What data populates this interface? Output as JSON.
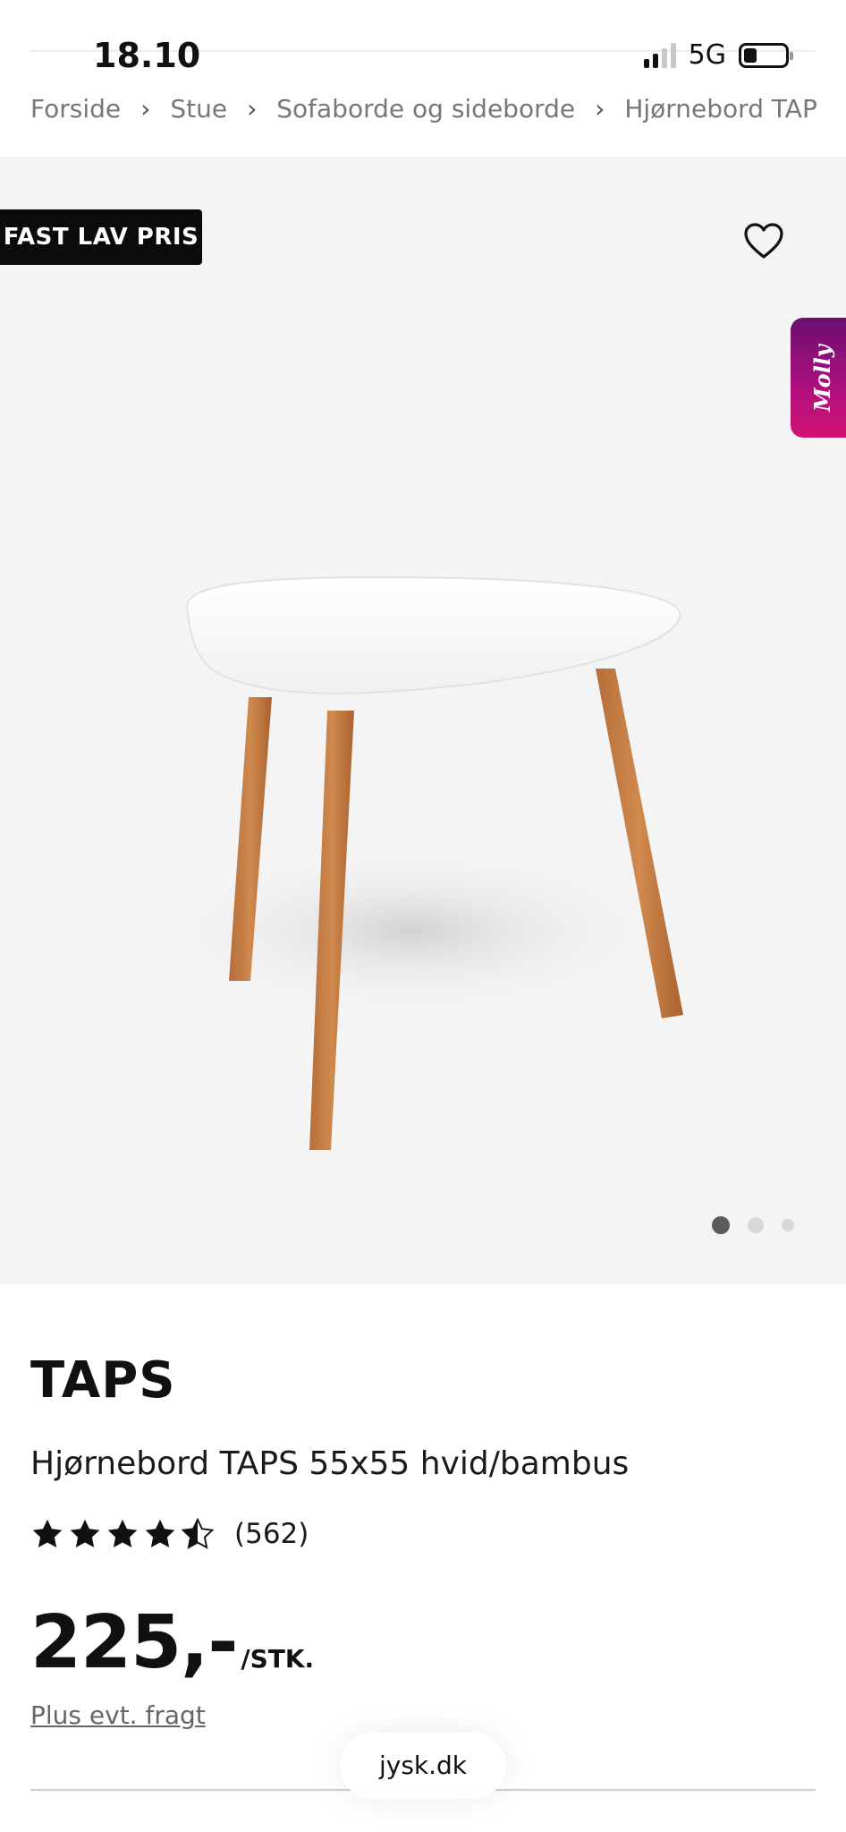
{
  "status_bar": {
    "time": "18.10",
    "network": "5G"
  },
  "breadcrumb": [
    "Forside",
    "Stue",
    "Sofaborde og sideborde",
    "Hjørnebord TAP"
  ],
  "hero": {
    "badge": "FAST LAV PRIS",
    "assistant_label": "Molly",
    "assistant_colors": [
      "#6a0f6e",
      "#d41274"
    ],
    "image_slide": {
      "current": 1,
      "total": 3
    }
  },
  "product": {
    "brand": "TAPS",
    "name": "Hjørnebord TAPS 55x55 hvid/bambus",
    "rating": 4.5,
    "review_count": "(562)",
    "price": "225,-",
    "unit": "/STK.",
    "freight_link": "Plus evt. fragt"
  },
  "browser": {
    "url": "jysk.dk"
  },
  "icons": [
    "signal-icon",
    "battery-icon",
    "chevron-right-icon",
    "heart-icon",
    "star-icon"
  ]
}
